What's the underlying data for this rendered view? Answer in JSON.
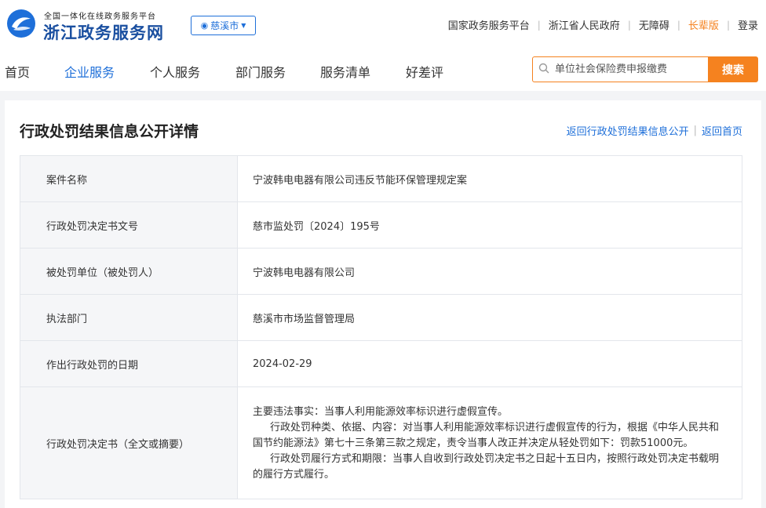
{
  "header": {
    "logo_small": "全国一体化在线政务服务平台",
    "logo_big": "浙江政务服务网",
    "city": "慈溪市",
    "links": [
      {
        "label": "国家政务服务平台"
      },
      {
        "label": "浙江省人民政府"
      },
      {
        "label": "无障碍"
      },
      {
        "label": "长辈版"
      },
      {
        "label": "登录"
      }
    ]
  },
  "nav": {
    "items": [
      {
        "label": "首页"
      },
      {
        "label": "企业服务"
      },
      {
        "label": "个人服务"
      },
      {
        "label": "部门服务"
      },
      {
        "label": "服务清单"
      },
      {
        "label": "好差评"
      }
    ],
    "active_index": 1,
    "search_placeholder": "单位社会保险费申报缴费",
    "search_button": "搜索"
  },
  "detail": {
    "title": "行政处罚结果信息公开详情",
    "back_link": "返回行政处罚结果信息公开",
    "home_link": "返回首页",
    "rows": [
      {
        "label": "案件名称",
        "value": "宁波韩电电器有限公司违反节能环保管理规定案"
      },
      {
        "label": "行政处罚决定书文号",
        "value": "慈市监处罚〔2024〕195号"
      },
      {
        "label": "被处罚单位（被处罚人）",
        "value": "宁波韩电电器有限公司"
      },
      {
        "label": "执法部门",
        "value": "慈溪市市场监督管理局"
      },
      {
        "label": "作出行政处罚的日期",
        "value": "2024-02-29"
      }
    ],
    "decision": {
      "label": "行政处罚决定书（全文或摘要）",
      "p1": "主要违法事实：当事人利用能源效率标识进行虚假宣传。",
      "p2": "行政处罚种类、依据、内容：对当事人利用能源效率标识进行虚假宣传的行为，根据《中华人民共和国节约能源法》第七十三条第三款之规定，责令当事人改正并决定从轻处罚如下：罚款51000元。",
      "p3": "行政处罚履行方式和期限：当事人自收到行政处罚决定书之日起十五日内，按照行政处罚决定书载明的履行方式履行。"
    }
  },
  "colors": {
    "brand_blue": "#1e6fd9",
    "accent_orange": "#f5821f"
  }
}
